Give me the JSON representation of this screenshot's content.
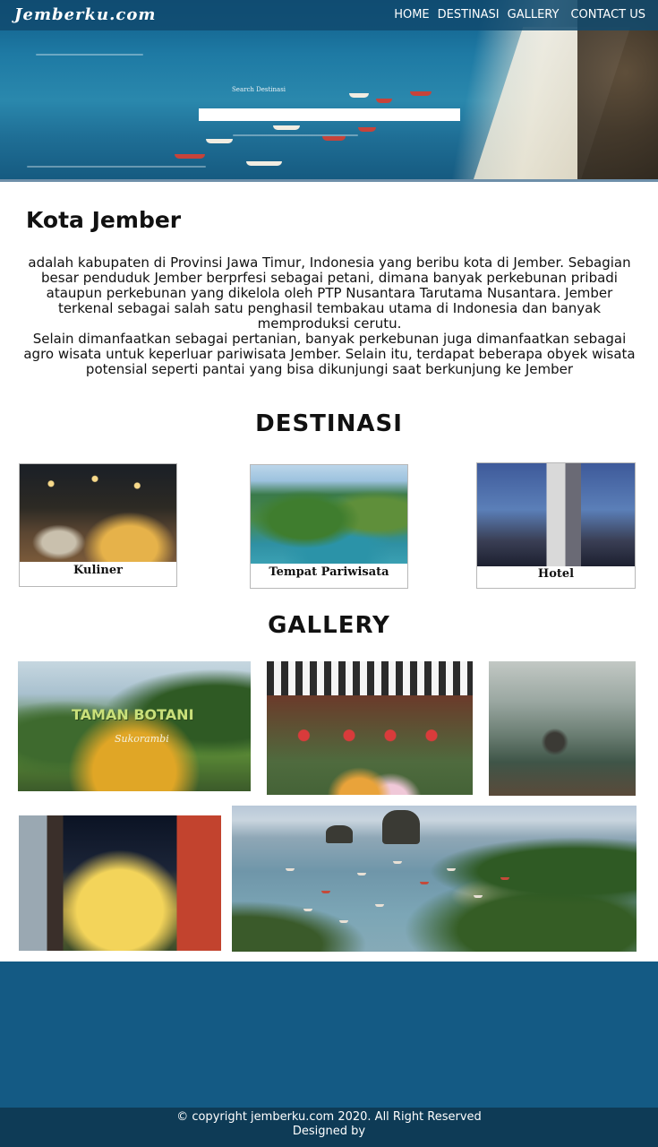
{
  "header": {
    "brand": "Jemberku.com",
    "nav": [
      "HOME",
      "DESTINASI",
      "GALLERY",
      "CONTACT US"
    ],
    "search_label": "Search Destinasi",
    "search_value": ""
  },
  "about": {
    "title": "Kota Jember",
    "paragraph1": "adalah kabupaten di Provinsi Jawa Timur, Indonesia yang beribu kota di Jember. Sebagian besar penduduk Jember berprfesi sebagai petani, dimana banyak perkebunan pribadi ataupun perkebunan yang dikelola oleh PTP Nusantara Tarutama Nusantara. Jember terkenal sebagai salah satu penghasil tembakau utama di Indonesia dan banyak memproduksi cerutu.",
    "paragraph2": "Selain dimanfaatkan sebagai pertanian, banyak perkebunan juga dimanfaatkan sebagai agro wisata untuk keperluar pariwisata Jember. Selain itu, terdapat beberapa obyek wisata potensial seperti pantai yang bisa dikunjungi saat berkunjung ke Jember"
  },
  "destinasi": {
    "title": "DESTINASI",
    "cards": [
      {
        "label": "Kuliner",
        "image": "food-photo"
      },
      {
        "label": "Tempat Pariwisata",
        "image": "coast-photo"
      },
      {
        "label": "Hotel",
        "image": "hotel-photo"
      }
    ]
  },
  "gallery": {
    "title": "GALLERY",
    "sign_text": "TAMAN BOTANI",
    "sign_subtext": "Sukorambi",
    "images": [
      "taman-botani-photo",
      "festival-photo",
      "misty-hill-photo",
      "night-village-photo",
      "beach-bay-photo"
    ]
  },
  "footer": {
    "copyright": "© copyright jemberku.com 2020. All Right Reserved",
    "designed_by": "Designed by"
  }
}
